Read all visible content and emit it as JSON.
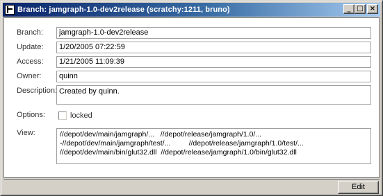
{
  "window": {
    "title": "Branch: jamgraph-1.0-dev2release (scratchy:1211, bruno)",
    "minimize_glyph": "_",
    "maximize_glyph": "□",
    "close_glyph": "×"
  },
  "form": {
    "branch": {
      "label": "Branch:",
      "value": "jamgraph-1.0-dev2release"
    },
    "update": {
      "label": "Update:",
      "value": "1/20/2005 07:22:59"
    },
    "access": {
      "label": "Access:",
      "value": "1/21/2005 11:09:39"
    },
    "owner": {
      "label": "Owner:",
      "value": "quinn"
    },
    "description": {
      "label": "Description:",
      "value": "Created by quinn."
    },
    "options": {
      "label": "Options:",
      "locked_label": "locked",
      "locked_checked": false
    },
    "view": {
      "label": "View:",
      "lines": [
        "//depot/dev/main/jamgraph/...   //depot/release/jamgraph/1.0/...",
        "-//depot/dev/main/jamgraph/test/...         //depot/release/jamgraph/1.0/test/...",
        "//depot/dev/main/bin/glut32.dll  //depot/release/jamgraph/1.0/bin/glut32.dll"
      ]
    }
  },
  "footer": {
    "edit_label": "Edit"
  }
}
